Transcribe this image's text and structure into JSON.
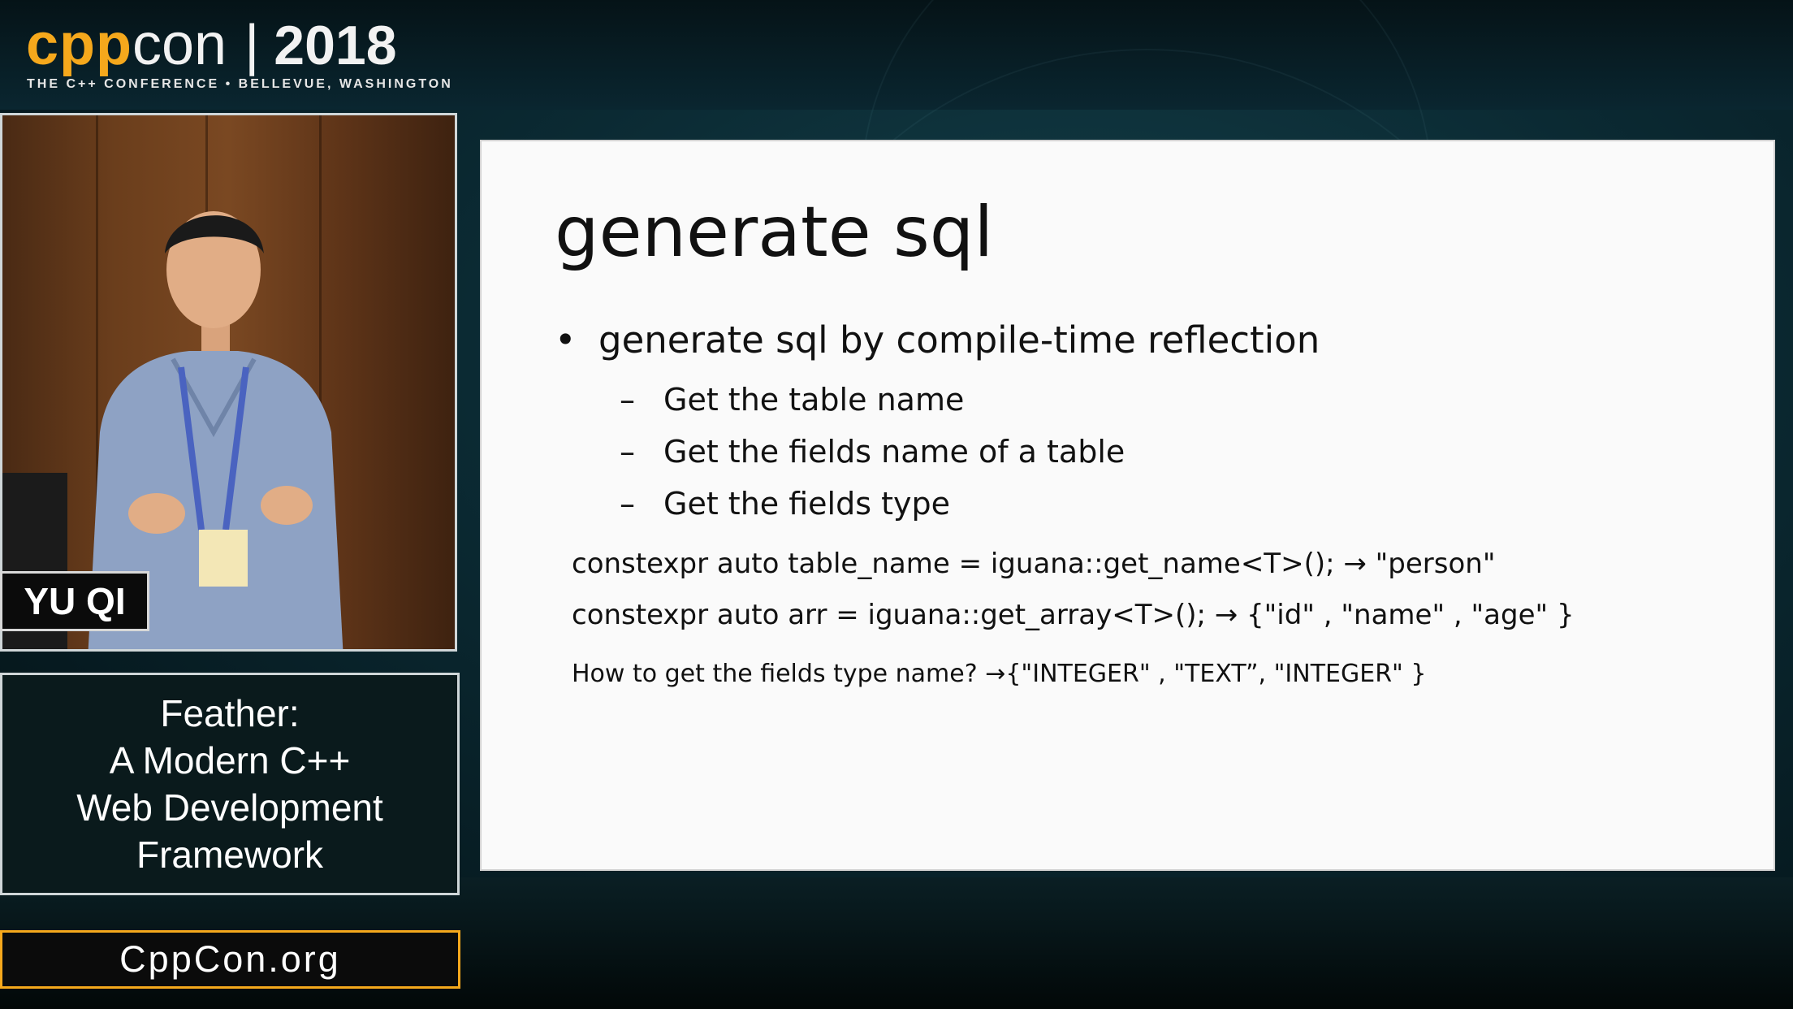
{
  "header": {
    "logo_cpp": "cpp",
    "logo_con": "con",
    "logo_separator": "|",
    "logo_year": "2018",
    "tagline": "THE C++ CONFERENCE • BELLEVUE, WASHINGTON"
  },
  "speaker": {
    "name": "YU QI"
  },
  "talk": {
    "title_lines": [
      "Feather:",
      "A Modern C++",
      "Web Development",
      "Framework"
    ]
  },
  "footer": {
    "site": "CppCon.org"
  },
  "slide": {
    "title": "generate sql",
    "bullet": {
      "marker": "•",
      "text": "generate sql by compile-time reflection"
    },
    "sub_items": [
      {
        "marker": "–",
        "text": "Get the table name"
      },
      {
        "marker": "–",
        "text": "Get the fields name of a table"
      },
      {
        "marker": "–",
        "text": "Get the fields type"
      }
    ],
    "code_lines": [
      "constexpr auto table_name = iguana::get_name<T>(); → \"person\"",
      "constexpr auto arr = iguana::get_array<T>(); → {\"id\" , \"name\" , \"age\" }"
    ],
    "question": "How to get the fields type name? →{\"INTEGER\" , \"TEXT”,  \"INTEGER\" }"
  },
  "colors": {
    "brand_orange": "#f5a81c",
    "slide_bg": "#fafafa",
    "text_dark": "#111111"
  }
}
